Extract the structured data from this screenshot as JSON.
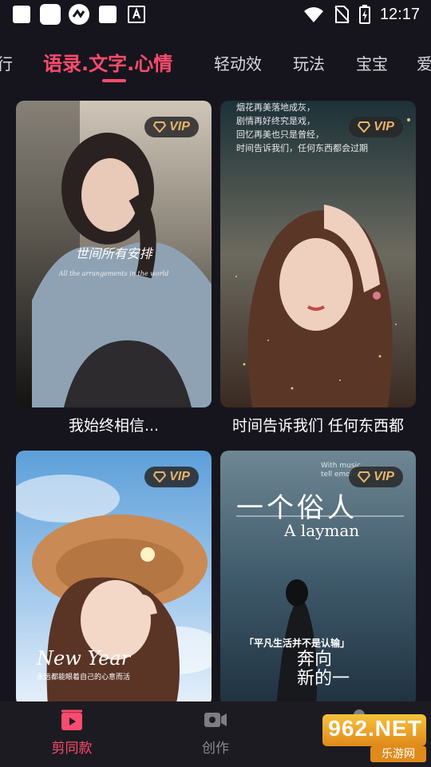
{
  "status_bar": {
    "time": "12:17"
  },
  "tabs": [
    {
      "label": "行"
    },
    {
      "label": "语录.文字.心情"
    },
    {
      "label": "轻动效"
    },
    {
      "label": "玩法"
    },
    {
      "label": "宝宝"
    },
    {
      "label": "爱"
    }
  ],
  "cards": [
    {
      "title": "我始终相信...",
      "badge": "VIP",
      "overlay_text": "世间所有安排",
      "overlay_sub": "All the arrangements in the world"
    },
    {
      "title": "时间告诉我们 任何东西都",
      "badge": "VIP",
      "overlay_text": "烟花再美落地成灰，\n剧情再好终究是戏，\n回忆再美也只是曾经，\n时间告诉我们，任何东西都会过期"
    },
    {
      "title": "",
      "badge": "VIP",
      "overlay_text": "New Year",
      "overlay_sub": "永远都能眼着自己的心意而活"
    },
    {
      "title": "",
      "badge": "VIP",
      "overlay_text": "一个俗人",
      "overlay_sub": "A layman",
      "overlay_small": "With music\ntell emotions",
      "overlay_quote": "「平凡生活并不是认输」",
      "overlay_bottom": "奔向\n新的一"
    }
  ],
  "bottom_nav": [
    {
      "label": "剪同款",
      "icon": "clapperboard-icon",
      "active": true
    },
    {
      "label": "创作",
      "icon": "video-camera-icon",
      "active": false
    },
    {
      "label": "",
      "icon": "person-icon",
      "active": false
    }
  ],
  "watermark": {
    "main": "962.NET",
    "sub": "乐游网"
  },
  "colors": {
    "accent": "#ff4b6e",
    "vip": "#e8b46b",
    "background": "#16151d"
  }
}
